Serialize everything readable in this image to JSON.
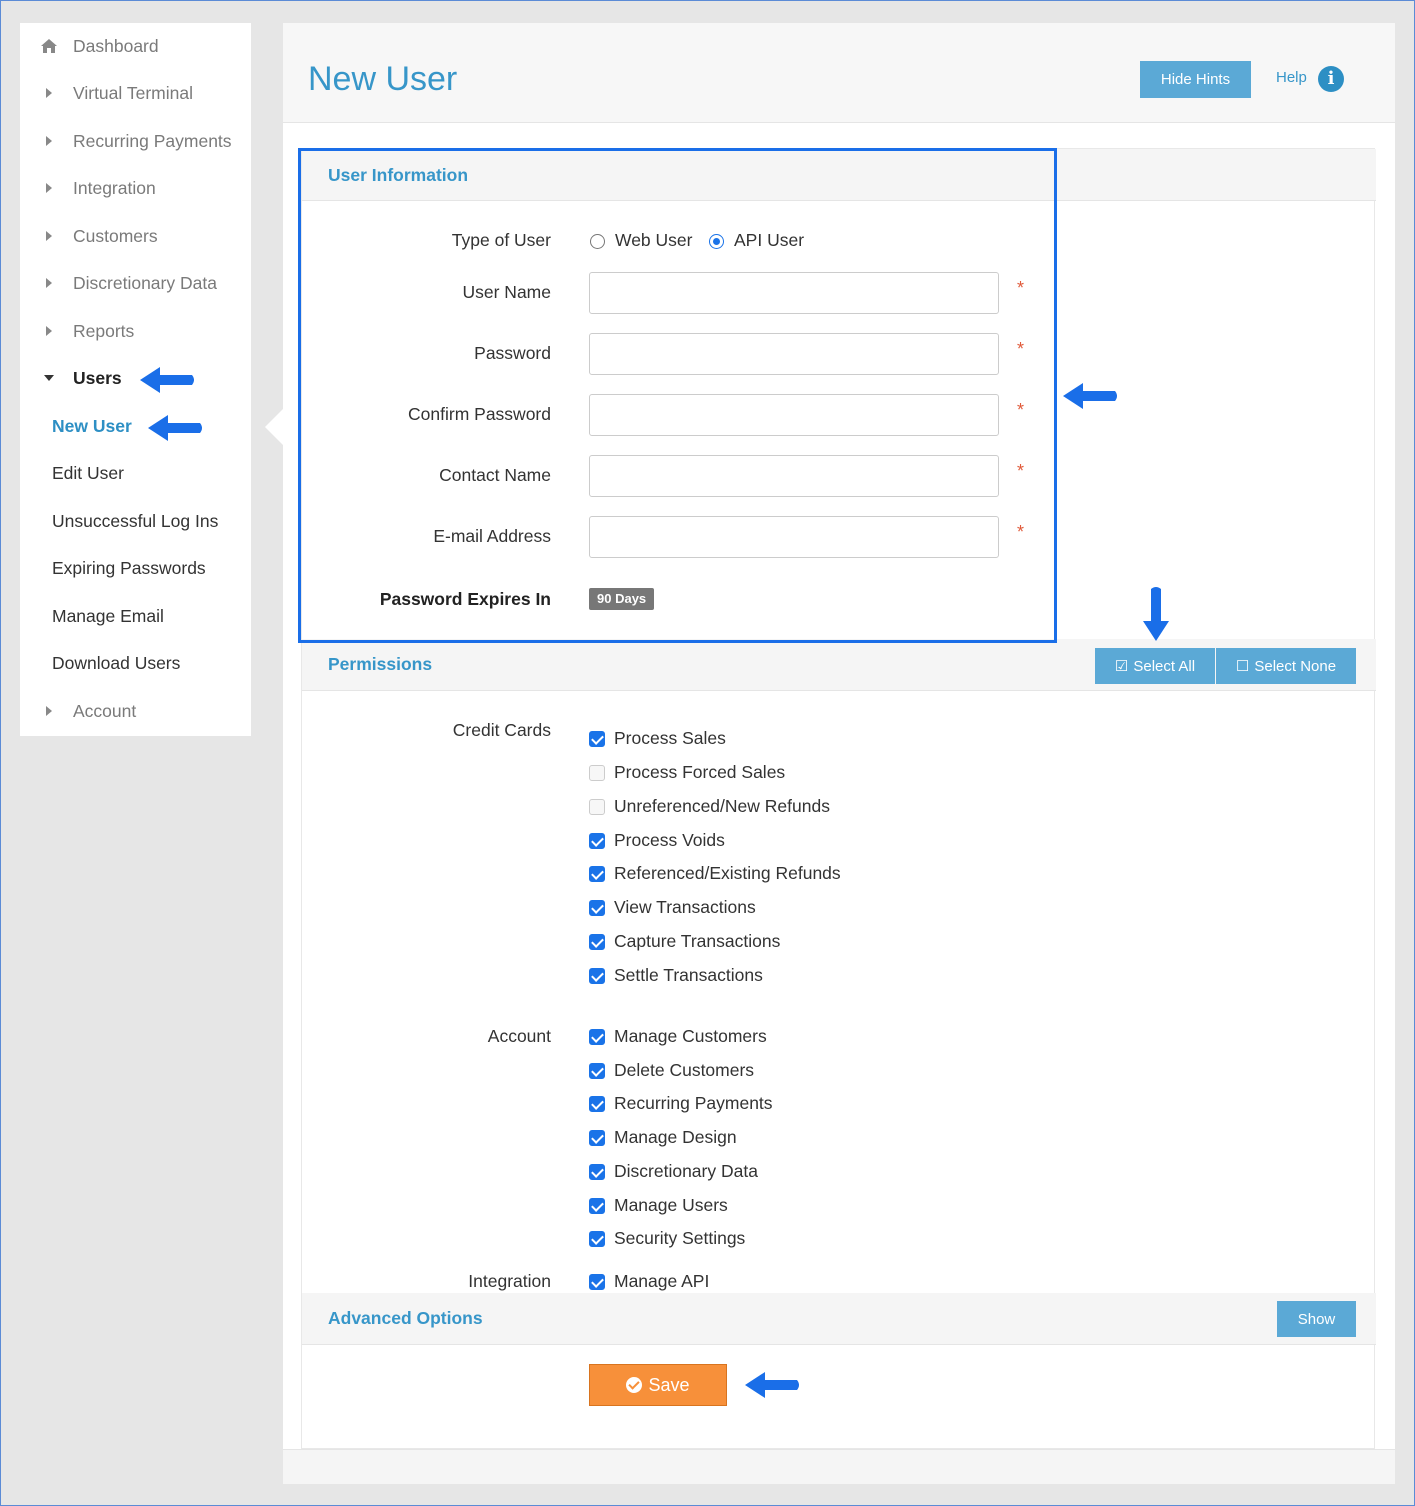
{
  "sidebar": {
    "items": [
      {
        "label": "Dashboard"
      },
      {
        "label": "Virtual Terminal"
      },
      {
        "label": "Recurring Payments"
      },
      {
        "label": "Integration"
      },
      {
        "label": "Customers"
      },
      {
        "label": "Discretionary Data"
      },
      {
        "label": "Reports"
      },
      {
        "label": "Users"
      },
      {
        "label": "Account"
      }
    ],
    "users_sub": [
      {
        "label": "New User"
      },
      {
        "label": "Edit User"
      },
      {
        "label": "Unsuccessful Log Ins"
      },
      {
        "label": "Expiring Passwords"
      },
      {
        "label": "Manage Email"
      },
      {
        "label": "Download Users"
      }
    ]
  },
  "header": {
    "title": "New User",
    "hide_hints": "Hide Hints",
    "help": "Help",
    "info_glyph": "i"
  },
  "user_info": {
    "title": "User Information",
    "type_label": "Type of User",
    "web_user": "Web User",
    "api_user": "API User",
    "selected_type": "API User",
    "fields": [
      {
        "label": "User Name",
        "value": ""
      },
      {
        "label": "Password",
        "value": ""
      },
      {
        "label": "Confirm Password",
        "value": ""
      },
      {
        "label": "Contact Name",
        "value": ""
      },
      {
        "label": "E-mail Address",
        "value": ""
      }
    ],
    "required_mark": "*",
    "expires_label": "Password Expires In",
    "expires_value": "90 Days"
  },
  "permissions": {
    "title": "Permissions",
    "select_all": "Select All",
    "select_none": "Select None",
    "credit_cards": {
      "label": "Credit Cards",
      "items": [
        {
          "label": "Process Sales",
          "checked": true
        },
        {
          "label": "Process Forced Sales",
          "checked": false
        },
        {
          "label": "Unreferenced/New Refunds",
          "checked": false
        },
        {
          "label": "Process Voids",
          "checked": true
        },
        {
          "label": "Referenced/Existing Refunds",
          "checked": true
        },
        {
          "label": "View Transactions",
          "checked": true
        },
        {
          "label": "Capture Transactions",
          "checked": true
        },
        {
          "label": "Settle Transactions",
          "checked": true
        }
      ]
    },
    "account": {
      "label": "Account",
      "items": [
        {
          "label": "Manage Customers",
          "checked": true
        },
        {
          "label": "Delete Customers",
          "checked": true
        },
        {
          "label": "Recurring Payments",
          "checked": true
        },
        {
          "label": "Manage Design",
          "checked": true
        },
        {
          "label": "Discretionary Data",
          "checked": true
        },
        {
          "label": "Manage Users",
          "checked": true
        },
        {
          "label": "Security Settings",
          "checked": true
        }
      ]
    },
    "integration": {
      "label": "Integration",
      "items": [
        {
          "label": "Manage API",
          "checked": true
        }
      ]
    }
  },
  "advanced": {
    "title": "Advanced Options",
    "show": "Show"
  },
  "save": {
    "label": "Save"
  },
  "colors": {
    "accent": "#3796c9",
    "button": "#5ba9d6",
    "save": "#f7903a",
    "annotation": "#1a6ee8",
    "required": "#e05a3a"
  }
}
